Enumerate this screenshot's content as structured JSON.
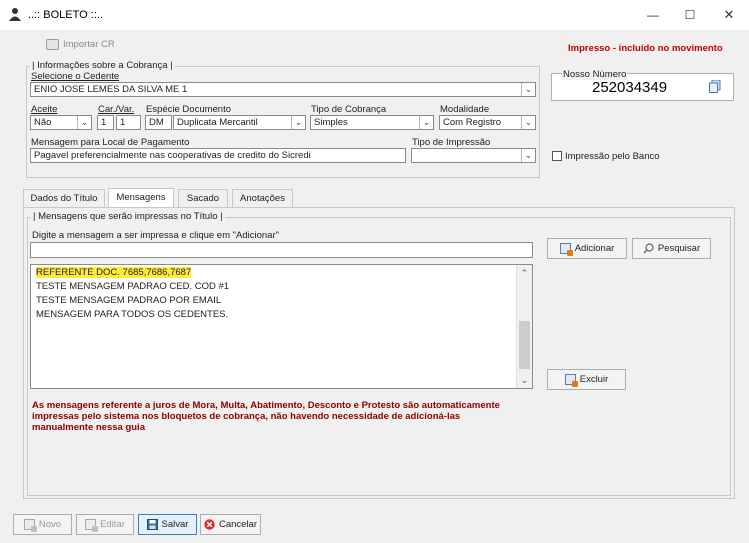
{
  "window": {
    "title": "..:: BOLETO ::..",
    "minimize": "—",
    "maximize": "☐",
    "close": "✕"
  },
  "toolbar": {
    "importar_label": "Importar CR"
  },
  "status": {
    "impresso_text": "Impresso - incluído no movimento"
  },
  "info_group": {
    "title": "| Informações sobre a Cobrança |",
    "cedente_label": "Selecione o Cedente",
    "cedente_value": "ENIO JOSE LEMES DA SILVA ME 1",
    "aceite_label": "Aceite",
    "aceite_value": "Não",
    "carvar_label": "Car./Var.",
    "car_value": "1",
    "var_value": "1",
    "especie_label": "Espécie Documento",
    "especie_code": "DM",
    "especie_value": "Duplicata Mercantil",
    "tipo_cobranca_label": "Tipo de Cobrança",
    "tipo_cobranca_value": "Simples",
    "modalidade_label": "Modalidade",
    "modalidade_value": "Com Registro",
    "mensagem_local_label": "Mensagem para Local de Pagamento",
    "mensagem_local_value": "Pagavel preferencialmente nas cooperativas de credito do Sicredi",
    "tipo_impressao_label": "Tipo de Impressão",
    "tipo_impressao_value": "",
    "impressao_banco_label": "Impressão pelo Banco"
  },
  "nosso_numero": {
    "label": "Nosso Número",
    "value": "252034349"
  },
  "tabs": [
    {
      "label": "Dados do Título"
    },
    {
      "label": "Mensagens"
    },
    {
      "label": "Sacado"
    },
    {
      "label": "Anotações"
    }
  ],
  "messages_group": {
    "title": "| Mensagens que serão impressas no Título |",
    "instruction": "Digite a mensagem a ser impressa e clique em \"Adicionar\"",
    "input_value": "",
    "adicionar_label": "Adicionar",
    "pesquisar_label": "Pesquisar",
    "excluir_label": "Excluir",
    "items": [
      "REFERENTE DOC. 7685,7686,7687",
      "TESTE MENSAGEM PADRAO CED. COD #1",
      "TESTE MENSAGEM PADRAO POR EMAIL",
      "MENSAGEM PARA TODOS OS CEDENTES."
    ],
    "warning_line1": "As mensagens referente a juros de Mora, Multa, Abatimento, Desconto e Protesto são automaticamente",
    "warning_line2": "impressas pelo sistema nos bloquetos de cobrança, não havendo necessidade de adicioná-las",
    "warning_line3": "manualmente nessa guia"
  },
  "footer": {
    "novo_label": "Novo",
    "editar_label": "Editar",
    "salvar_label": "Salvar",
    "cancelar_label": "Cancelar"
  },
  "colors": {
    "accent_red": "#c00000",
    "highlight_yellow": "#ffeb3b",
    "cancel_red": "#d9322f",
    "save_blue": "#3c7fb1"
  }
}
